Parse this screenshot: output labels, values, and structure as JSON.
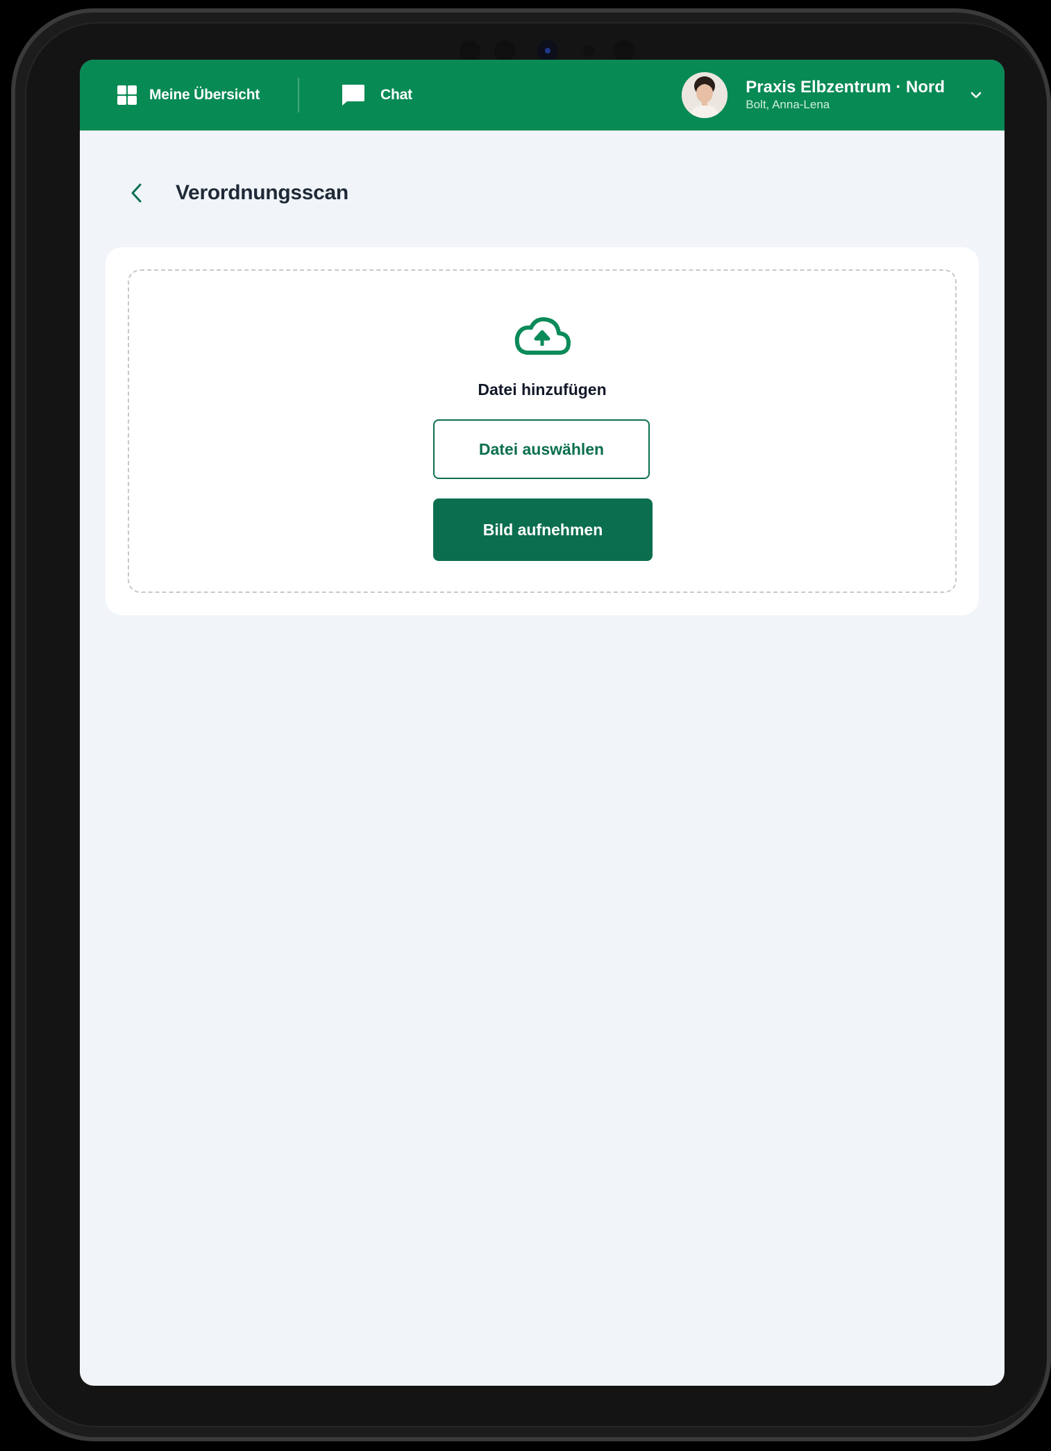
{
  "colors": {
    "brand": "#088a55",
    "primary_button": "#0b6e4f",
    "screen_background": "#f1f5f9",
    "card_background": "#ffffff"
  },
  "topbar": {
    "nav": [
      {
        "label": "Meine Übersicht",
        "icon": "grid-icon"
      },
      {
        "label": "Chat",
        "icon": "chat-icon"
      }
    ],
    "profile": {
      "practice": "Praxis Elbzentrum · Nord",
      "user": "Bolt, Anna-Lena",
      "avatar": "avatar",
      "menu_icon": "chevron-down-icon"
    }
  },
  "page": {
    "back_icon": "chevron-left-icon",
    "title": "Verordnungsscan"
  },
  "upload": {
    "icon": "cloud-upload-icon",
    "title": "Datei hinzufügen",
    "select_label": "Datei auswählen",
    "capture_label": "Bild aufnehmen"
  }
}
